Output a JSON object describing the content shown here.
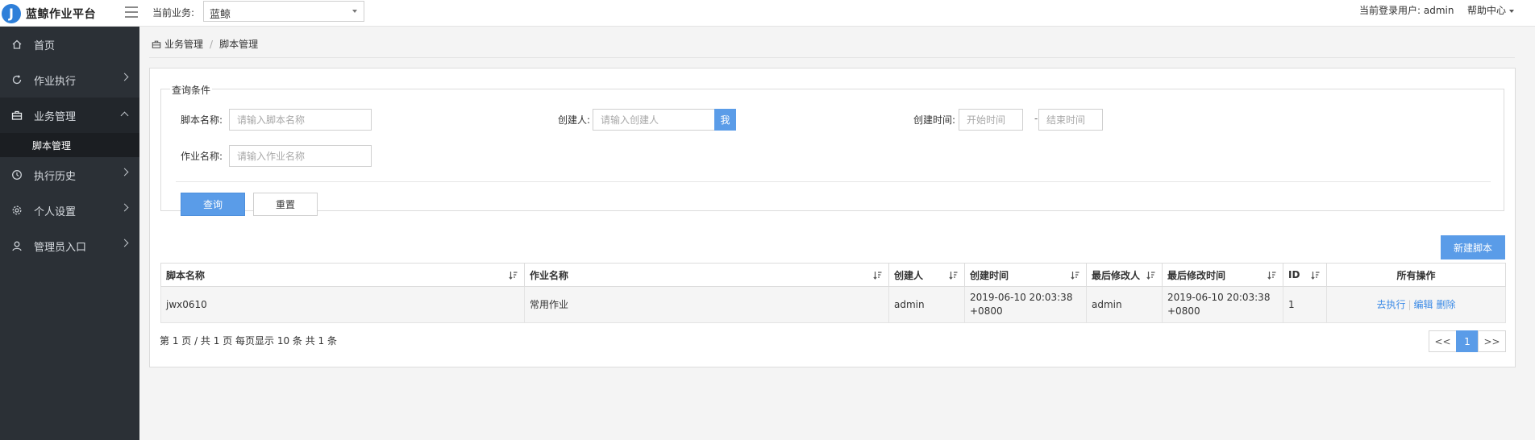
{
  "header": {
    "app_title": "蓝鲸作业平台",
    "logo_letter": "J",
    "biz_label": "当前业务:",
    "biz_selected": "蓝鲸",
    "user_info": "当前登录用户: admin",
    "help_label": "帮助中心"
  },
  "sidebar": {
    "items": [
      {
        "label": "首页",
        "icon": "home-icon"
      },
      {
        "label": "作业执行",
        "icon": "refresh-icon"
      },
      {
        "label": "业务管理",
        "icon": "briefcase-icon"
      },
      {
        "label": "执行历史",
        "icon": "clock-icon"
      },
      {
        "label": "个人设置",
        "icon": "gear-icon"
      },
      {
        "label": "管理员入口",
        "icon": "user-icon"
      }
    ],
    "sub_item": "脚本管理"
  },
  "breadcrumb": {
    "parent": "业务管理",
    "separator": "/",
    "current": "脚本管理"
  },
  "query": {
    "legend": "查询条件",
    "script_name_label": "脚本名称:",
    "script_name_placeholder": "请输入脚本名称",
    "creator_label": "创建人:",
    "creator_placeholder": "请输入创建人",
    "me_button": "我",
    "create_time_label": "创建时间:",
    "start_placeholder": "开始时间",
    "range_dash": "-",
    "end_placeholder": "结束时间",
    "job_name_label": "作业名称:",
    "job_name_placeholder": "请输入作业名称",
    "query_button": "查询",
    "reset_button": "重置"
  },
  "new_script_button": "新建脚本",
  "table": {
    "headers": [
      "脚本名称",
      "作业名称",
      "创建人",
      "创建时间",
      "最后修改人",
      "最后修改时间",
      "ID",
      "所有操作"
    ],
    "rows": [
      {
        "script_name": "jwx0610",
        "job_name": "常用作业",
        "creator": "admin",
        "create_time_1": "2019-06-10 20:03:38",
        "create_time_2": "+0800",
        "modifier": "admin",
        "modify_time_1": "2019-06-10 20:03:38",
        "modify_time_2": "+0800",
        "id": "1",
        "op_execute": "去执行",
        "op_sep": "|",
        "op_edit": "编辑",
        "op_delete": "删除"
      }
    ]
  },
  "pagination": {
    "info": "第 1 页 / 共 1 页  每页显示 10 条  共 1 条",
    "prev": "<<",
    "current": "1",
    "next": ">>"
  },
  "colors": {
    "accent": "#5a9ce8",
    "sidebar_bg": "#2b3036",
    "link": "#3a8ae6"
  }
}
